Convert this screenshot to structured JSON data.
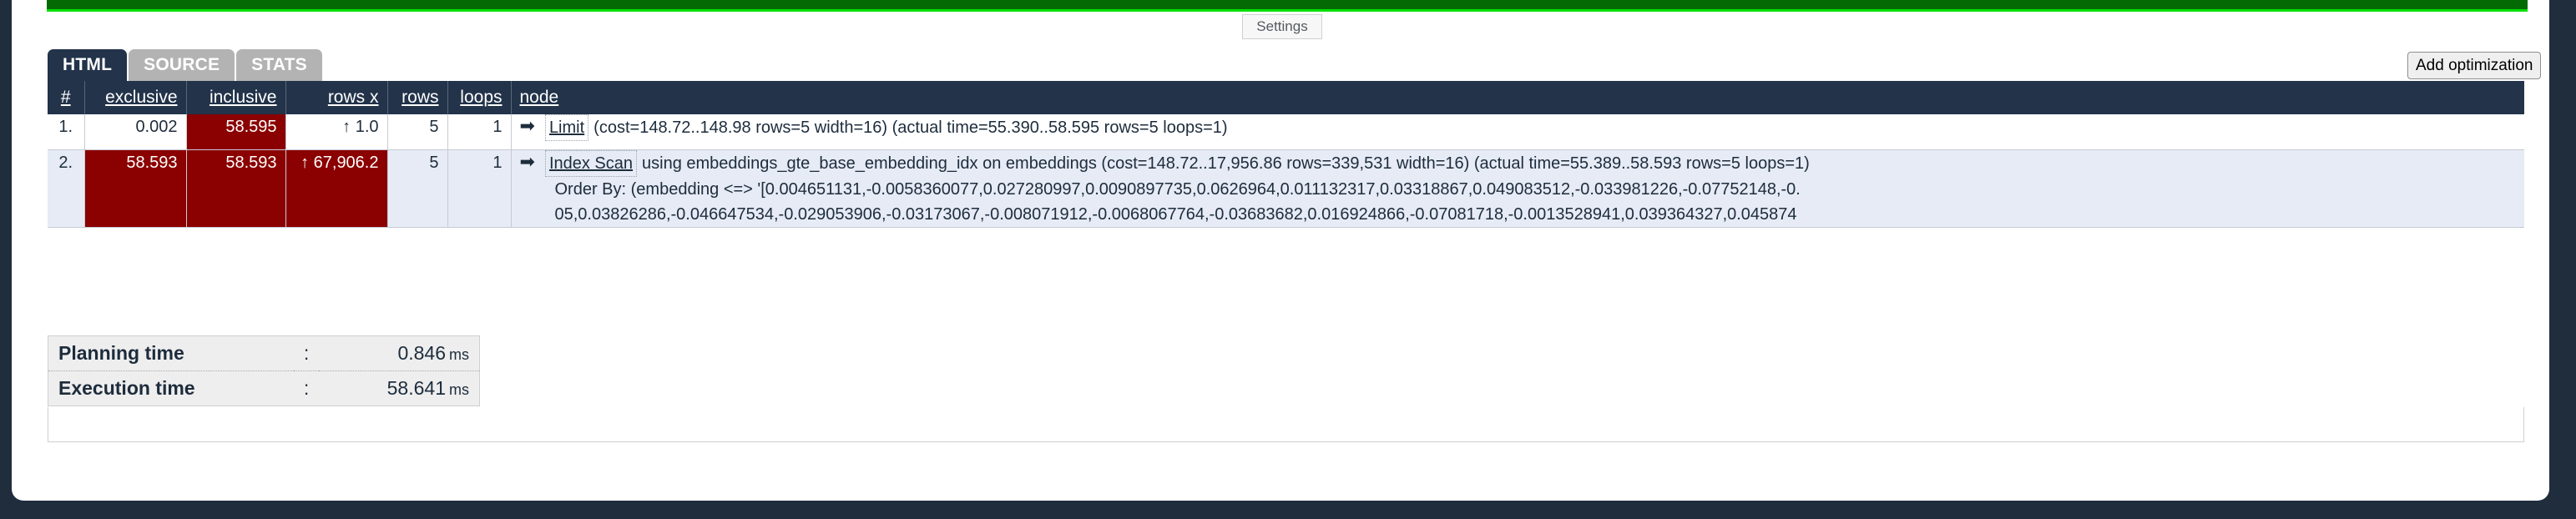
{
  "window": {
    "background_color": "#1f2d3d",
    "card_background": "#ffffff"
  },
  "progress": {
    "label": "",
    "fill_color": "#046a04",
    "track_color": "#00e000",
    "percent": 100
  },
  "toolbar": {
    "settings_label": "Settings",
    "add_optimization_label": "Add optimization"
  },
  "tabs": [
    {
      "label": "HTML",
      "active": true
    },
    {
      "label": "SOURCE",
      "active": false
    },
    {
      "label": "STATS",
      "active": false
    }
  ],
  "plan_table": {
    "headers": {
      "num": "#",
      "exclusive": "exclusive",
      "inclusive": "inclusive",
      "rows_x": "rows x",
      "rows": "rows",
      "loops": "loops",
      "node": "node"
    },
    "rows": [
      {
        "num": "1.",
        "exclusive": "0.002",
        "inclusive": "58.595",
        "rows_x": "↑ 1.0",
        "rows": "5",
        "loops": "1",
        "arrow": "➡",
        "node_type": "Limit",
        "node_detail": "(cost=148.72..148.98 rows=5 width=16) (actual time=55.390..58.595 rows=5 loops=1)",
        "extra_lines": [],
        "heat": {
          "exclusive": false,
          "inclusive": true,
          "rows_x": false
        }
      },
      {
        "num": "2.",
        "exclusive": "58.593",
        "inclusive": "58.593",
        "rows_x": "↑ 67,906.2",
        "rows": "5",
        "loops": "1",
        "arrow": "➡",
        "node_type": "Index Scan",
        "node_detail": "using embeddings_gte_base_embedding_idx on embeddings (cost=148.72..17,956.86 rows=339,531 width=16) (actual time=55.389..58.593 rows=5 loops=1)",
        "extra_lines": [
          "Order By: (embedding <=> '[0.004651131,-0.0058360077,0.027280997,0.0090897735,0.0626964,0.011132317,0.03318867,0.049083512,-0.033981226,-0.07752148,-0.",
          "05,0.03826286,-0.046647534,-0.029053906,-0.03173067,-0.008071912,-0.0068067764,-0.03683682,0.016924866,-0.07081718,-0.0013528941,0.039364327,0.045874"
        ],
        "heat": {
          "exclusive": true,
          "inclusive": true,
          "rows_x": true
        }
      }
    ],
    "heat_color": "#8b0000",
    "header_background": "#22334a"
  },
  "timings": [
    {
      "label": "Planning time",
      "separator": ":",
      "value": "0.846",
      "unit": "ms"
    },
    {
      "label": "Execution time",
      "separator": ":",
      "value": "58.641",
      "unit": "ms"
    }
  ]
}
